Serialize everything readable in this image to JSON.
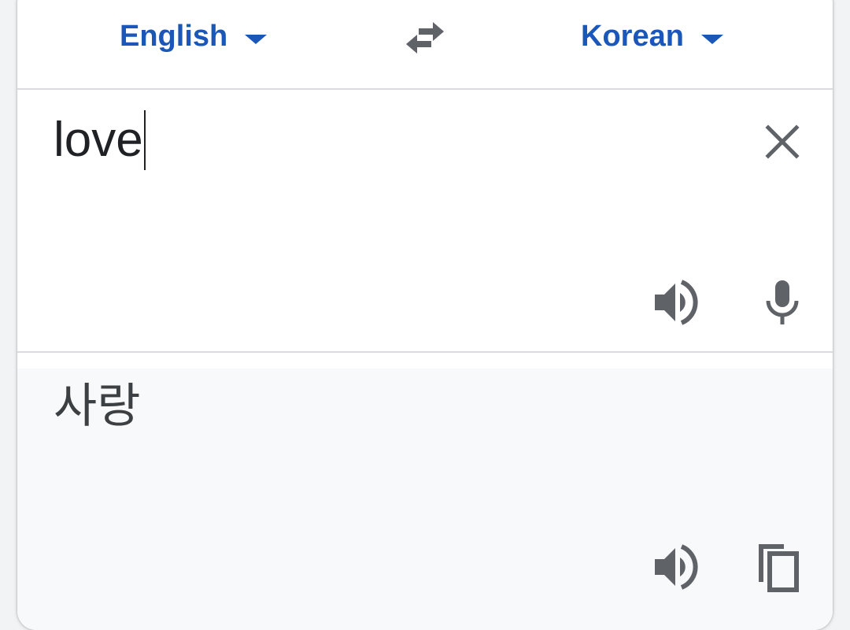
{
  "languages": {
    "source": "English",
    "target": "Korean"
  },
  "source": {
    "text": "love"
  },
  "target": {
    "text": "사랑"
  },
  "icons": {
    "swap": "swap-arrows-icon",
    "clear": "close-icon",
    "speak": "speaker-icon",
    "mic": "microphone-icon",
    "copy": "copy-icon",
    "dropdown": "caret-down-icon"
  },
  "colors": {
    "accent": "#1a57b8",
    "icon": "#5f6368",
    "target_bg": "#f8f9fa",
    "divider": "#dadce0"
  }
}
